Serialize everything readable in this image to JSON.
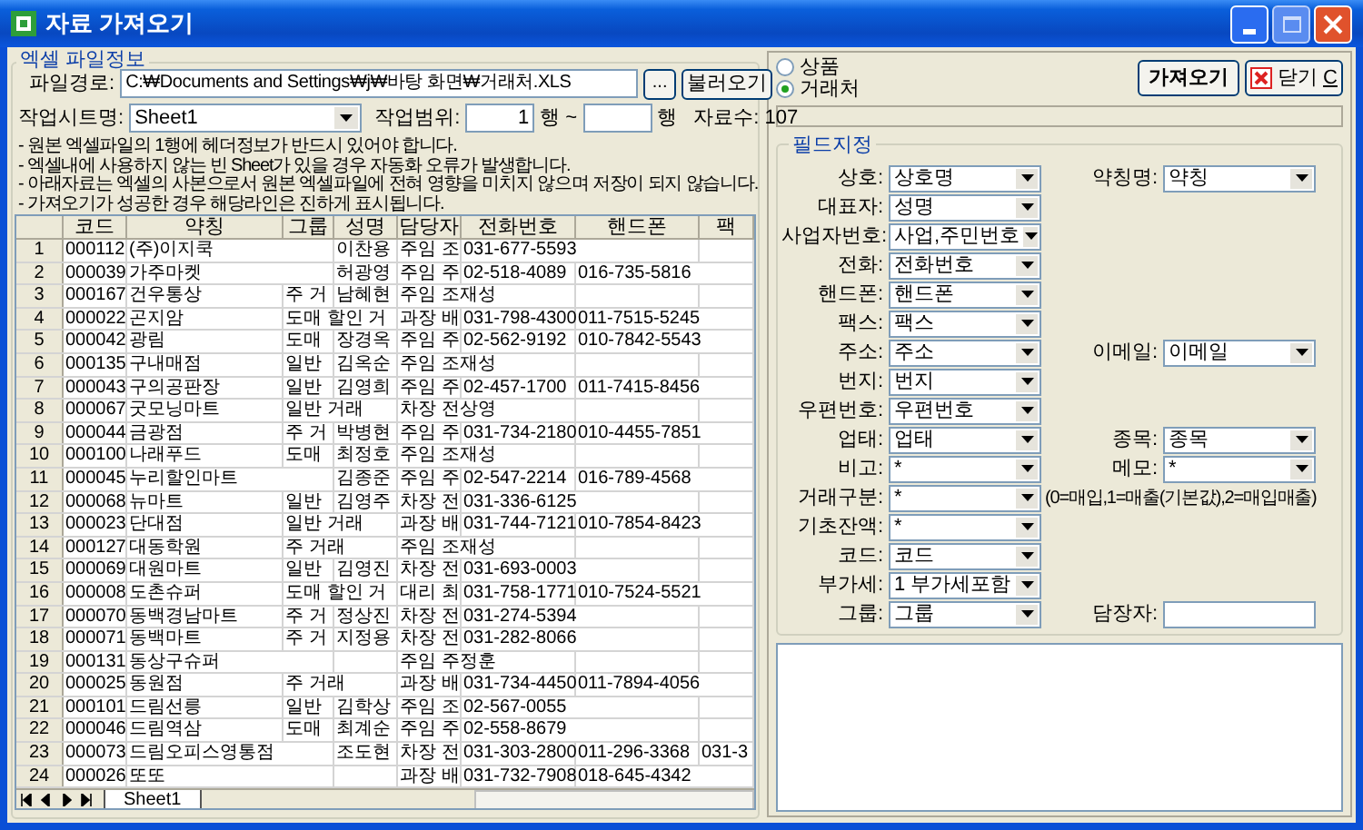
{
  "window": {
    "title": "자료 가져오기"
  },
  "excel_file_info": {
    "title": "엑셀 파일정보",
    "file_path": {
      "label": "파일경로:",
      "value": "C:₩Documents and Settings₩j₩바탕 화면₩거래처.XLS"
    },
    "browse_button": "...",
    "load_button": "불러오기",
    "sheet": {
      "label": "작업시트명:",
      "value": "Sheet1"
    },
    "range": {
      "label": "작업범위:",
      "start": "1",
      "start_unit": "행 ~",
      "end_unit": "행"
    },
    "record_count": "자료수: 107",
    "notes": [
      "- 원본 엑셀파일의 1행에 헤더정보가 반드시 있어야 합니다.",
      "- 엑셀내에 사용하지 않는 빈 Sheet가 있을 경우 자동화 오류가 발생합니다.",
      "- 아래자료는 엑셀의 사본으로서 원본 엑셀파일에 전혀 영향을 미치지 않으며 저장이 되지 않습니다.",
      "- 가져오기가 성공한 경우 해당라인은 진하게 표시됩니다."
    ]
  },
  "table": {
    "columns": [
      "코드",
      "약칭",
      "그룹",
      "성명",
      "담당자",
      "전화번호",
      "핸드폰",
      "팩"
    ],
    "rows": [
      {
        "number": "1",
        "cells": [
          "000112",
          "(주)이지쿡",
          null,
          "이찬용",
          "주임 조",
          "031-677-5593",
          null,
          null
        ]
      },
      {
        "number": "2",
        "cells": [
          "000039",
          "가주마켓",
          null,
          "허광영",
          "주임 주",
          "02-518-4089",
          "016-735-5816",
          null
        ]
      },
      {
        "number": "3",
        "cells": [
          "000167",
          "건우통상",
          "주 거",
          "남혜현",
          "주임 조재성",
          null,
          null,
          null
        ]
      },
      {
        "number": "4",
        "cells": [
          "000022",
          "곤지암",
          "도매 할인 거",
          null,
          "과장 배",
          "031-798-4300",
          "011-7515-5245",
          null
        ]
      },
      {
        "number": "5",
        "cells": [
          "000042",
          "광림",
          "도매",
          "장경옥",
          "주임 주",
          "02-562-9192",
          "010-7842-5543",
          null
        ]
      },
      {
        "number": "6",
        "cells": [
          "000135",
          "구내매점",
          "일반",
          "김옥순",
          "주임 조재성",
          null,
          null,
          null
        ]
      },
      {
        "number": "7",
        "cells": [
          "000043",
          "구의공판장",
          "일반",
          "김영희",
          "주임 주",
          "02-457-1700",
          "011-7415-8456",
          null
        ]
      },
      {
        "number": "8",
        "cells": [
          "000067",
          "굿모닝마트",
          "일반 거래",
          null,
          "차장 전상영",
          null,
          null,
          null
        ]
      },
      {
        "number": "9",
        "cells": [
          "000044",
          "금광점",
          "주 거",
          "박병현",
          "주임 주",
          "031-734-2180",
          "010-4455-7851",
          null
        ]
      },
      {
        "number": "10",
        "cells": [
          "000100",
          "나래푸드",
          "도매",
          "최정호",
          "주임 조재성",
          null,
          null,
          null
        ]
      },
      {
        "number": "11",
        "cells": [
          "000045",
          "누리할인마트",
          null,
          "김종준",
          "주임 주",
          "02-547-2214",
          "016-789-4568",
          null
        ]
      },
      {
        "number": "12",
        "cells": [
          "000068",
          "뉴마트",
          "일반",
          "김영주",
          "차장 전",
          "031-336-6125",
          null,
          null
        ]
      },
      {
        "number": "13",
        "cells": [
          "000023",
          "단대점",
          "일반 거래",
          null,
          "과장 배",
          "031-744-7121",
          "010-7854-8423",
          null
        ]
      },
      {
        "number": "14",
        "cells": [
          "000127",
          "대동학원",
          "주 거래",
          null,
          "주임 조재성",
          null,
          null,
          null
        ]
      },
      {
        "number": "15",
        "cells": [
          "000069",
          "대원마트",
          "일반",
          "김영진",
          "차장 전",
          "031-693-0003",
          null,
          null
        ]
      },
      {
        "number": "16",
        "cells": [
          "000008",
          "도촌슈퍼",
          "도매 할인 거",
          null,
          "대리 최",
          "031-758-1771",
          "010-7524-5521",
          null
        ]
      },
      {
        "number": "17",
        "cells": [
          "000070",
          "동백경남마트",
          "주 거",
          "정상진",
          "차장 전",
          "031-274-5394",
          null,
          null
        ]
      },
      {
        "number": "18",
        "cells": [
          "000071",
          "동백마트",
          "주 거",
          "지정용",
          "차장 전",
          "031-282-8066",
          null,
          null
        ]
      },
      {
        "number": "19",
        "cells": [
          "000131",
          "동상구슈퍼",
          null,
          null,
          "주임 주정훈",
          null,
          null,
          null
        ]
      },
      {
        "number": "20",
        "cells": [
          "000025",
          "동원점",
          "주 거래",
          null,
          "과장 배",
          "031-734-4450",
          "011-7894-4056",
          null
        ]
      },
      {
        "number": "21",
        "cells": [
          "000101",
          "드림선릉",
          "일반",
          "김학상",
          "주임 조",
          "02-567-0055",
          null,
          null
        ]
      },
      {
        "number": "22",
        "cells": [
          "000046",
          "드림역삼",
          "도매",
          "최계순",
          "주임 주",
          "02-558-8679",
          null,
          null
        ]
      },
      {
        "number": "23",
        "cells": [
          "000073",
          "드림오피스영통점",
          null,
          "조도현",
          "차장 전",
          "031-303-2800",
          "011-296-3368",
          "031-3"
        ]
      },
      {
        "number": "24",
        "cells": [
          "000026",
          "또또",
          null,
          null,
          "과장 배",
          "031-732-7908",
          "018-645-4342",
          null
        ]
      }
    ]
  },
  "sheet_tabs": [
    {
      "label": "Sheet1",
      "selected": true
    }
  ],
  "import_type": [
    {
      "label": "상품",
      "selected": false
    },
    {
      "label": "거래처",
      "selected": true
    }
  ],
  "import_button": "가져오기",
  "close_button": {
    "label": "닫기",
    "access_key": "C"
  },
  "progress": {
    "level": 0
  },
  "field_mapping": {
    "title": "필드지정",
    "rows": [
      {
        "left": {
          "label": "상호:",
          "value": "상호명"
        },
        "right": {
          "kind": "combo",
          "label": "약칭명:",
          "value": "약칭"
        }
      },
      {
        "left": {
          "label": "대표자:",
          "value": "성명"
        }
      },
      {
        "left": {
          "label": "사업자번호:",
          "value": "사업,주민번호"
        }
      },
      {
        "left": {
          "label": "전화:",
          "value": "전화번호"
        }
      },
      {
        "left": {
          "label": "핸드폰:",
          "value": "핸드폰"
        }
      },
      {
        "left": {
          "label": "팩스:",
          "value": "팩스"
        }
      },
      {
        "left": {
          "label": "주소:",
          "value": "주소"
        },
        "right": {
          "kind": "combo",
          "label": "이메일:",
          "value": "이메일"
        }
      },
      {
        "left": {
          "label": "번지:",
          "value": "번지"
        }
      },
      {
        "left": {
          "label": "우편번호:",
          "value": "우편번호"
        }
      },
      {
        "left": {
          "label": "업태:",
          "value": "업태"
        },
        "right": {
          "kind": "combo",
          "label": "종목:",
          "value": "종목"
        }
      },
      {
        "left": {
          "label": "비고:",
          "value": "*"
        },
        "right": {
          "kind": "combo",
          "label": "메모:",
          "value": "*"
        }
      },
      {
        "left": {
          "label": "거래구분:",
          "value": "*"
        },
        "right": {
          "kind": "note",
          "text": "(0=매입,1=매출(기본값),2=매입매출)"
        }
      },
      {
        "left": {
          "label": "기초잔액:",
          "value": "*"
        }
      },
      {
        "left": {
          "label": "코드:",
          "value": "코드"
        }
      },
      {
        "left": {
          "label": "부가세:",
          "value": "1 부가세포함"
        }
      },
      {
        "left": {
          "label": "그룹:",
          "value": "그룹"
        },
        "right": {
          "kind": "text",
          "label": "담장자:"
        }
      }
    ]
  }
}
